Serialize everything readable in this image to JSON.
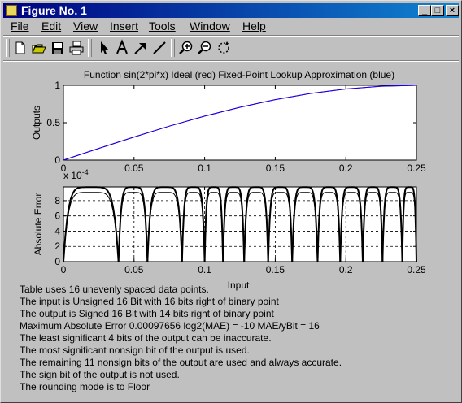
{
  "window": {
    "title": "Figure No. 1"
  },
  "menu": [
    "File",
    "Edit",
    "View",
    "Insert",
    "Tools",
    "Window",
    "Help"
  ],
  "toolbar_icons": [
    "new-file-icon",
    "open-folder-icon",
    "save-icon",
    "print-icon",
    "arrow-select-icon",
    "text-a-icon",
    "arrow-icon",
    "line-icon",
    "zoom-in-icon",
    "zoom-out-icon",
    "rotate-icon"
  ],
  "colors": {
    "ideal": "#ff0000",
    "approx": "#0000ff",
    "error": "#000000"
  },
  "chart_data": [
    {
      "type": "line",
      "title": "Function sin(2*pi*x)     Ideal (red)   Fixed-Point Lookup Approximation (blue)",
      "xlabel": "",
      "ylabel": "Outputs",
      "xlim": [
        0,
        0.25
      ],
      "ylim": [
        0,
        1
      ],
      "x_ticks": [
        "0",
        "0.05",
        "0.1",
        "0.15",
        "0.2",
        "0.25"
      ],
      "y_ticks": [
        "0",
        "0.5",
        "1"
      ],
      "grid": false,
      "series": [
        {
          "name": "Ideal",
          "color": "#ff0000",
          "x": [
            0,
            0.025,
            0.05,
            0.075,
            0.1,
            0.125,
            0.15,
            0.175,
            0.2,
            0.225,
            0.25
          ],
          "y": [
            0,
            0.156,
            0.309,
            0.454,
            0.588,
            0.707,
            0.809,
            0.891,
            0.951,
            0.988,
            1.0
          ]
        },
        {
          "name": "Fixed-Point Lookup Approximation",
          "color": "#0000ff",
          "x": [
            0,
            0.025,
            0.05,
            0.075,
            0.1,
            0.125,
            0.15,
            0.175,
            0.2,
            0.225,
            0.25
          ],
          "y": [
            0,
            0.156,
            0.309,
            0.454,
            0.588,
            0.707,
            0.809,
            0.891,
            0.951,
            0.988,
            1.0
          ]
        }
      ]
    },
    {
      "type": "line",
      "title": "",
      "exponent_label": "x 10",
      "exponent_power": "-4",
      "xlabel": "Input",
      "ylabel": "Absolute Error",
      "xlim": [
        0,
        0.25
      ],
      "ylim": [
        0,
        9.8
      ],
      "x_ticks": [
        "0",
        "0.05",
        "0.1",
        "0.15",
        "0.2",
        "0.25"
      ],
      "y_ticks": [
        "0",
        "2",
        "4",
        "6",
        "8"
      ],
      "grid": true,
      "arch_breakpoints": [
        0,
        0.039,
        0.0595,
        0.084,
        0.1,
        0.113,
        0.128,
        0.145,
        0.162,
        0.18,
        0.196,
        0.212,
        0.226,
        0.24,
        0.25
      ],
      "peak_error": 9.7656
    }
  ],
  "info_lines": [
    "Table uses 16 unevenly spaced data points.",
    "The input is Unsigned 16 Bit with 16 bits right of binary point",
    "The output is Signed 16 Bit with 14 bits right of binary point",
    "Maximum Absolute Error  0.00097656   log2(MAE) = -10   MAE/yBit = 16",
    "The least significant 4 bits of the output can be inaccurate.",
    "The most significant nonsign bit of the output is used.",
    "The remaining 11 nonsign bits of the output are used and always accurate.",
    "The sign bit of the output is not used.",
    "The rounding mode is to Floor"
  ]
}
